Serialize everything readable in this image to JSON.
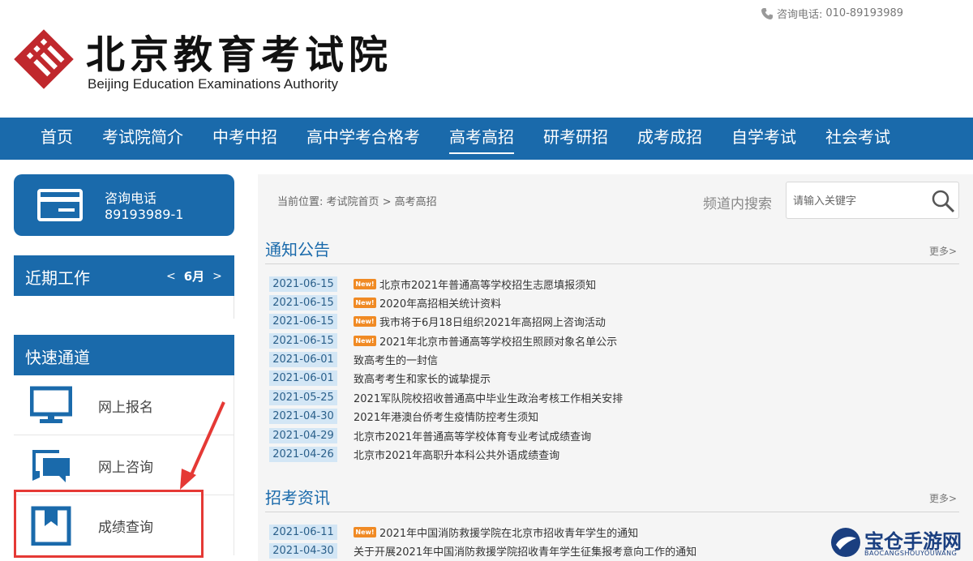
{
  "header": {
    "logo_cn": "北京教育考试院",
    "logo_en": "Beijing Education Examinations Authority",
    "hotline_label": "咨询电话:",
    "hotline_number": "010-89193989",
    "brand_color": "#c0282d"
  },
  "nav": {
    "accent": "#1a6aab",
    "items": [
      {
        "label": "首页"
      },
      {
        "label": "考试院简介"
      },
      {
        "label": "中考中招"
      },
      {
        "label": "高中学考合格考"
      },
      {
        "label": "高考高招",
        "active": true
      },
      {
        "label": "研考研招"
      },
      {
        "label": "成考成招"
      },
      {
        "label": "自学考试"
      },
      {
        "label": "社会考试"
      }
    ]
  },
  "sidebar": {
    "consult": {
      "label": "咨询电话",
      "number": "89193989-1",
      "icon": "card-icon"
    },
    "recent": {
      "title": "近期工作",
      "prev": "<",
      "month": "6月",
      "next": ">"
    },
    "quick": {
      "title": "快速通道",
      "items": [
        {
          "label": "网上报名",
          "icon": "monitor-icon"
        },
        {
          "label": "网上咨询",
          "icon": "chat-icon"
        },
        {
          "label": "成绩查询",
          "icon": "bookmark-icon"
        }
      ]
    }
  },
  "main": {
    "breadcrumb": "当前位置: 考试院首页 > 高考高招",
    "search": {
      "label": "频道内搜索",
      "placeholder": "请输入关键字",
      "icon": "search-icon"
    },
    "more_label": "更多>",
    "notices": {
      "title": "通知公告",
      "items": [
        {
          "date": "2021-06-15",
          "new": true,
          "title": "北京市2021年普通高等学校招生志愿填报须知"
        },
        {
          "date": "2021-06-15",
          "new": true,
          "title": "2020年高招相关统计资料"
        },
        {
          "date": "2021-06-15",
          "new": true,
          "title": "我市将于6月18日组织2021年高招网上咨询活动"
        },
        {
          "date": "2021-06-15",
          "new": true,
          "title": "2021年北京市普通高等学校招生照顾对象名单公示"
        },
        {
          "date": "2021-06-01",
          "new": false,
          "title": "致高考生的一封信"
        },
        {
          "date": "2021-06-01",
          "new": false,
          "title": "致高考考生和家长的诚挚提示"
        },
        {
          "date": "2021-05-25",
          "new": false,
          "title": "2021军队院校招收普通高中毕业生政治考核工作相关安排"
        },
        {
          "date": "2021-04-30",
          "new": false,
          "title": "2021年港澳台侨考生疫情防控考生须知"
        },
        {
          "date": "2021-04-29",
          "new": false,
          "title": "北京市2021年普通高等学校体育专业考试成绩查询"
        },
        {
          "date": "2021-04-26",
          "new": false,
          "title": "北京市2021年高职升本科公共外语成绩查询"
        }
      ]
    },
    "recruit": {
      "title": "招考资讯",
      "items": [
        {
          "date": "2021-06-11",
          "new": true,
          "title": "2021年中国消防救援学院在北京市招收青年学生的通知"
        },
        {
          "date": "2021-04-30",
          "new": false,
          "title": "关于开展2021年中国消防救援学院招收青年学生征集报考意向工作的通知"
        }
      ]
    },
    "new_badge": "New!"
  },
  "watermark": {
    "text": "宝仓手游网",
    "sub": "BAOCANGSHOUYOUWANG"
  }
}
